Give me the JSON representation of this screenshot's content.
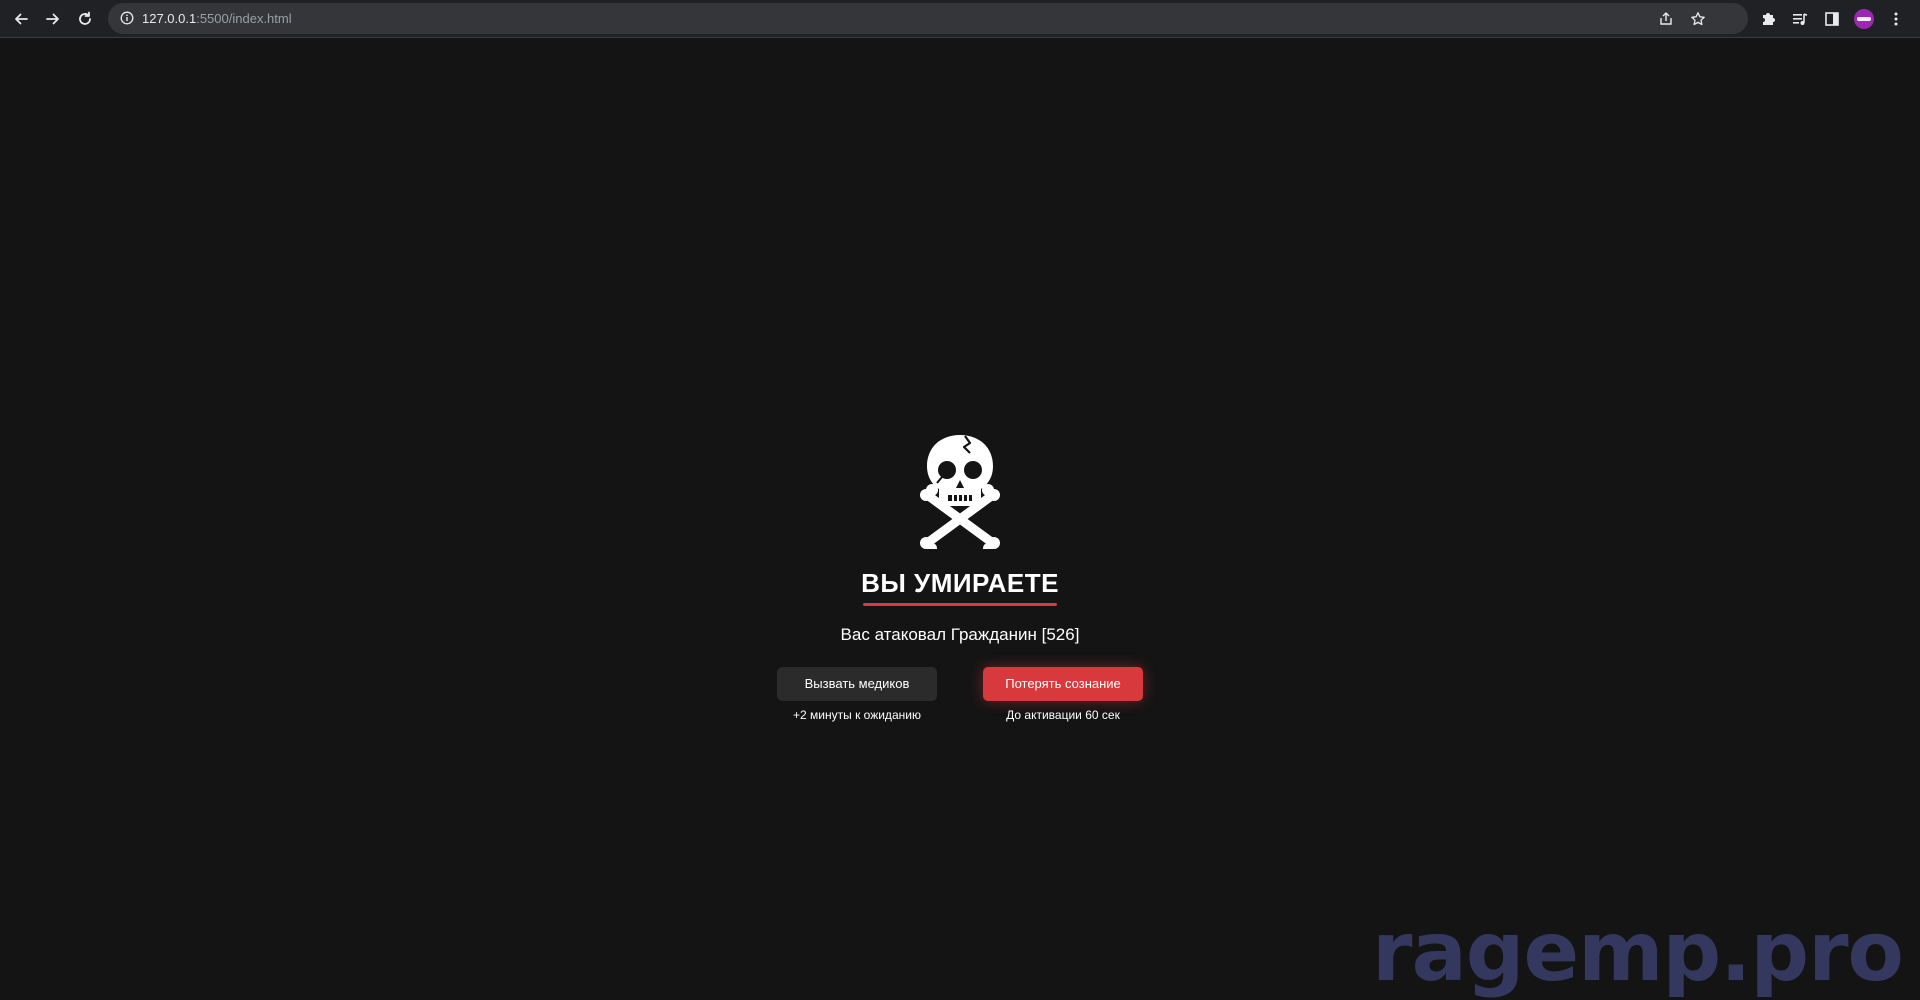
{
  "browser": {
    "url_host": "127.0.0.1",
    "url_path": ":5500/index.html"
  },
  "icons": {
    "back": "arrow-left-icon",
    "forward": "arrow-right-icon",
    "reload": "reload-icon",
    "site_info": "info-icon",
    "share": "share-icon",
    "bookmark": "star-icon",
    "extensions": "puzzle-icon",
    "media": "playlist-icon",
    "side_panel": "side-panel-icon",
    "menu": "kebab-menu-icon",
    "skull": "skull-crossbones-icon"
  },
  "death_screen": {
    "title": "ВЫ УМИРАЕТЕ",
    "attacker_text": "Вас атаковал Гражданин [526]",
    "medics_button": "Вызвать медиков",
    "medics_hint": "+2 минуты к ожиданию",
    "unconscious_button": "Потерять сознание",
    "unconscious_hint": "До активации 60 сек"
  },
  "watermark": "ragemp.pro",
  "colors": {
    "background": "#141414",
    "accent_red": "#d8393c",
    "secondary_button": "#2b2b2c",
    "watermark": "#363a63"
  }
}
